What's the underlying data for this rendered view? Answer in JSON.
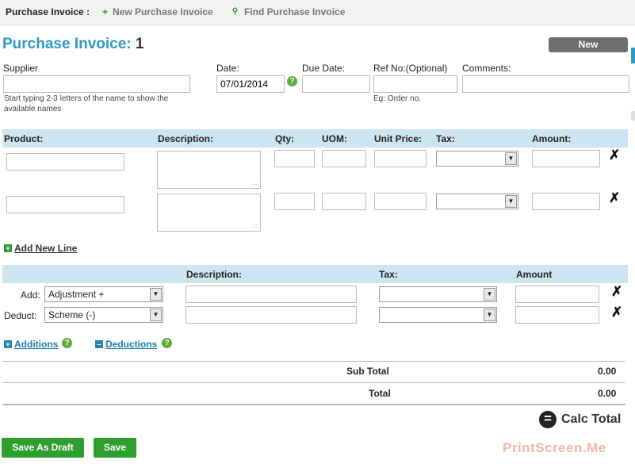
{
  "topbar": {
    "brand": "Purchase Invoice :",
    "new_link": "New Purchase Invoice",
    "find_link": "Find Purchase Invoice",
    "new_icon": "+",
    "find_icon": "🔍"
  },
  "header": {
    "title": "Purchase Invoice:",
    "number": "1",
    "status_button": "New"
  },
  "form": {
    "supplier_label": "Supplier",
    "supplier_value": "",
    "supplier_help": "Start typing 2-3 letters of the name to show the available names",
    "date_label": "Date:",
    "date_value": "07/01/2014",
    "help_icon": "?",
    "due_label": "Due Date:",
    "due_value": "",
    "ref_label": "Ref No:(Optional)",
    "ref_value": "",
    "ref_help": "Eg: Order no.",
    "comments_label": "Comments:",
    "comments_value": ""
  },
  "lines_table": {
    "headers": [
      "Product:",
      "Description:",
      "Qty:",
      "UOM:",
      "Unit Price:",
      "Tax:",
      "Amount:"
    ],
    "rows": [
      {
        "product": "",
        "description": "",
        "qty": "",
        "uom": "",
        "unit_price": "",
        "tax": "",
        "amount": ""
      },
      {
        "product": "",
        "description": "",
        "qty": "",
        "uom": "",
        "unit_price": "",
        "tax": "",
        "amount": ""
      }
    ],
    "delete_icon": "✗",
    "add_line_label": "Add New Line"
  },
  "adjustments_table": {
    "headers": [
      "Description:",
      "Tax:",
      "Amount"
    ],
    "rows": [
      {
        "label": "Add:",
        "type": "Adjustment +",
        "description": "",
        "tax": "",
        "amount": ""
      },
      {
        "label": "Deduct:",
        "type": "Scheme (-)",
        "description": "",
        "tax": "",
        "amount": ""
      }
    ],
    "additions_label": "Additions",
    "deductions_label": "Deductions"
  },
  "totals": {
    "subtotal_label": "Sub Total",
    "subtotal_value": "0.00",
    "total_label": "Total",
    "total_value": "0.00",
    "calc_label": "Calc Total",
    "calc_icon": "="
  },
  "actions": {
    "draft_label": "Save As Draft",
    "save_label": "Save"
  },
  "watermark": "PrintScreen.Me",
  "colors": {
    "accent": "#2a9bc6",
    "header_bg": "#cde5f0",
    "button_green": "#2e9e2e"
  }
}
